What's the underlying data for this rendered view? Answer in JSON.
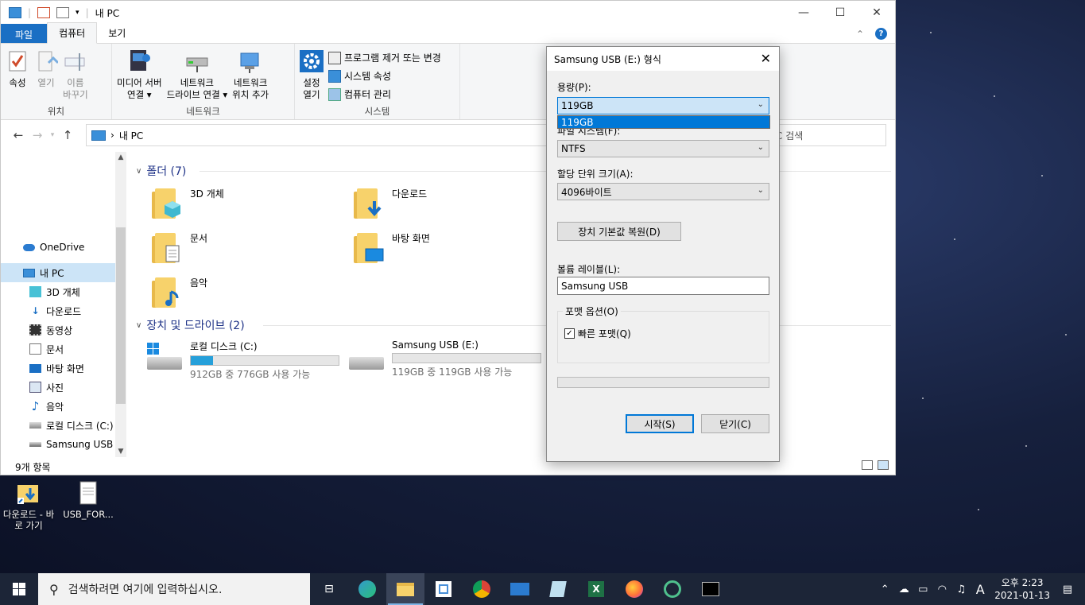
{
  "explorer": {
    "title": "내 PC",
    "tabs": [
      "파일",
      "컴퓨터",
      "보기"
    ],
    "ribbon": {
      "location": {
        "label": "위치",
        "properties": "속성",
        "open": "열기",
        "rename_1": "이름",
        "rename_2": "바꾸기"
      },
      "network": {
        "label": "네트워크",
        "media_1": "미디어 서버",
        "media_2": "연결 ▾",
        "map_1": "네트워크",
        "map_2": "드라이브 연결 ▾",
        "add_1": "네트워크",
        "add_2": "위치 추가"
      },
      "system": {
        "label": "시스템",
        "settings_1": "설정",
        "settings_2": "열기",
        "uninstall": "프로그램 제거 또는 변경",
        "sysprops": "시스템 속성",
        "manage": "컴퓨터 관리"
      }
    },
    "address": {
      "path": "내 PC",
      "search_placeholder": "C 검색"
    },
    "nav": {
      "onedrive": "OneDrive",
      "thispc": "내 PC",
      "items": [
        "3D 개체",
        "다운로드",
        "동영상",
        "문서",
        "바탕 화면",
        "사진",
        "음악",
        "로컬 디스크 (C:)",
        "Samsung USB (E:)"
      ]
    },
    "folders_header": "폴더 (7)",
    "folders": [
      "3D 개체",
      "다운로드",
      "문서",
      "바탕 화면",
      "음악"
    ],
    "drives_header": "장치 및 드라이브 (2)",
    "drives": [
      {
        "name": "로컬 디스크 (C:)",
        "free": "912GB 중 776GB 사용 가능",
        "used_fraction": 0.15
      },
      {
        "name": "Samsung USB (E:)",
        "free": "119GB 중 119GB 사용 가능",
        "used_fraction": 0.0
      }
    ],
    "status": "9개 항목"
  },
  "dialog": {
    "title": "Samsung USB (E:) 형식",
    "capacity_label": "용량(P):",
    "capacity_value": "119GB",
    "capacity_option": "119GB",
    "filesystem_label": "파일 시스템(F):",
    "filesystem_value": "NTFS",
    "alloc_label": "할당 단위 크기(A):",
    "alloc_value": "4096바이트",
    "restore_button": "장치 기본값 복원(D)",
    "volume_label": "볼륨 레이블(L):",
    "volume_value": "Samsung USB",
    "options_legend": "포맷 옵션(O)",
    "quick_format": "빠른 포맷(Q)",
    "quick_format_checked": true,
    "start_button": "시작(S)",
    "close_button": "닫기(C)"
  },
  "desktop": {
    "icons": [
      {
        "label": "다운로드 - 바로 가기"
      },
      {
        "label": "USB_FOR..."
      }
    ]
  },
  "taskbar": {
    "search_placeholder": "검색하려면 여기에 입력하십시오.",
    "clock_time": "오후 2:23",
    "clock_date": "2021-01-13",
    "ime": "A"
  }
}
